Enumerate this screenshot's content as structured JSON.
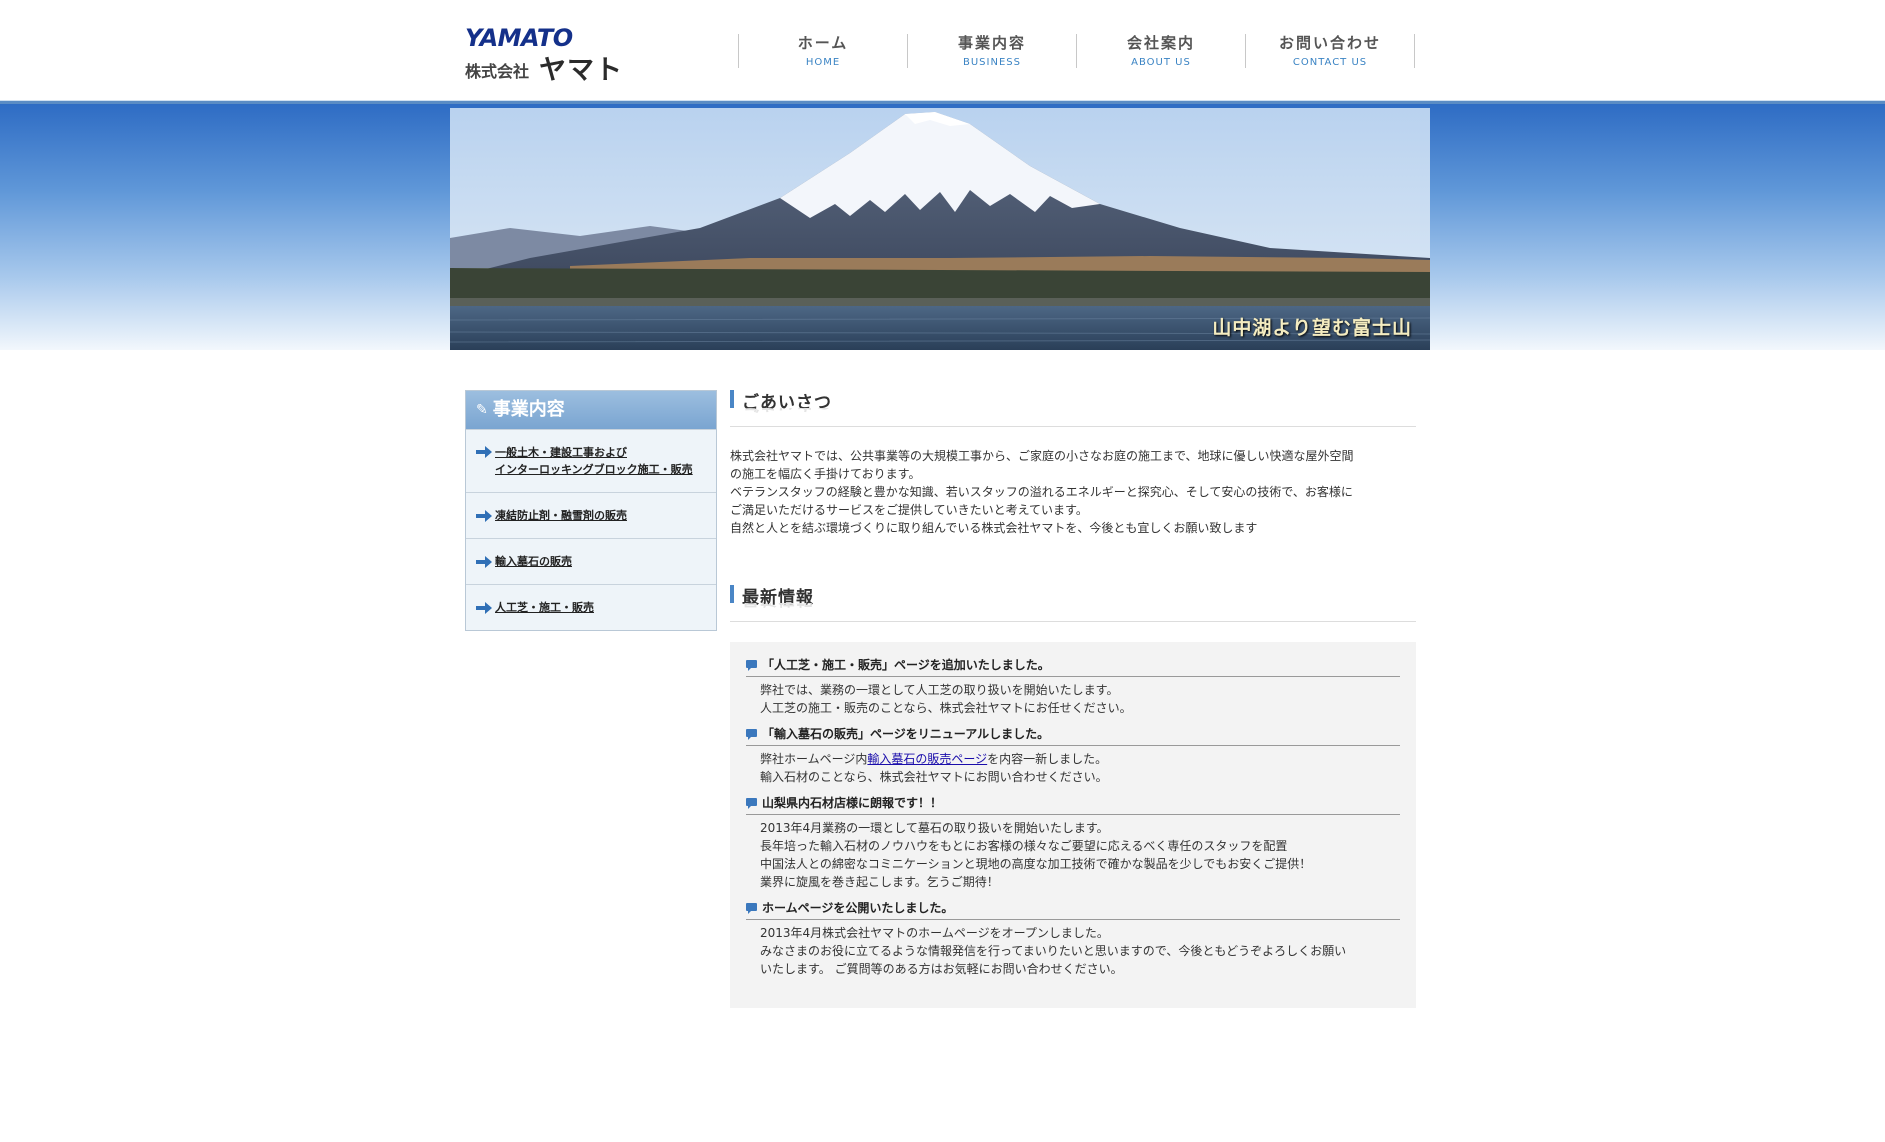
{
  "header": {
    "logo_en": "YAMATO",
    "logo_jp_prefix": "株式会社",
    "logo_jp_name": "ヤマト",
    "nav": [
      {
        "jp": "ホーム",
        "en": "HOME"
      },
      {
        "jp": "事業内容",
        "en": "BUSINESS"
      },
      {
        "jp": "会社案内",
        "en": "ABOUT US"
      },
      {
        "jp": "お問い合わせ",
        "en": "CONTACT US"
      }
    ]
  },
  "hero": {
    "caption": "山中湖より望む富士山"
  },
  "sidebar": {
    "title": "事業内容",
    "items": [
      {
        "line1": "一般土木・建設工事および",
        "line2": "インターロッキングブロック施工・販売"
      },
      {
        "line1": "凍結防止剤・融雪剤の販売",
        "line2": ""
      },
      {
        "line1": "輸入墓石の販売",
        "line2": ""
      },
      {
        "line1": "人工芝・施工・販売",
        "line2": ""
      }
    ]
  },
  "greeting": {
    "title": "ごあいさつ",
    "lines": [
      "株式会社ヤマトでは、公共事業等の大規模工事から、ご家庭の小さなお庭の施工まで、地球に優しい快適な屋外空間",
      "の施工を幅広く手掛けております。",
      "ベテランスタッフの経験と豊かな知識、若いスタッフの溢れるエネルギーと探究心、そして安心の技術で、お客様に",
      "ご満足いただけるサービスをご提供していきたいと考えています。",
      "自然と人とを結ぶ環境づくりに取り組んでいる株式会社ヤマトを、今後とも宜しくお願い致します"
    ]
  },
  "news": {
    "title": "最新情報",
    "items": [
      {
        "title": "「人工芝・施工・販売」ページを追加いたしました。",
        "lines": [
          "弊社では、業務の一環として人工芝の取り扱いを開始いたします。",
          "人工芝の施工・販売のことなら、株式会社ヤマトにお任せください。"
        ]
      },
      {
        "title": "「輸入墓石の販売」ページをリニューアルしました。",
        "line1_prefix": "弊社ホームページ内",
        "line1_link": "輸入墓石の販売ページ",
        "line1_suffix": "を内容一新しました。",
        "lines": [
          "輸入石材のことなら、株式会社ヤマトにお問い合わせください。"
        ]
      },
      {
        "title": "山梨県内石材店様に朗報です！！",
        "lines": [
          "2013年4月業務の一環として墓石の取り扱いを開始いたします。",
          "長年培った輸入石材のノウハウをもとにお客様の様々なご要望に応えるべく専任のスタッフを配置",
          "中国法人との綿密なコミニケーションと現地の高度な加工技術で確かな製品を少しでもお安くご提供！",
          "業界に旋風を巻き起こします。乞うご期待！"
        ]
      },
      {
        "title": "ホームページを公開いたしました。",
        "lines": [
          "2013年4月株式会社ヤマトのホームページをオープンしました。",
          "みなさまのお役に立てるような情報発信を行ってまいりたいと思いますので、今後ともどうぞよろしくお願い",
          "いたします。 ご質問等のある方はお気軽にお問い合わせください。"
        ]
      }
    ]
  },
  "colors": {
    "accent": "#4a86c6",
    "nav_en": "#3b84c4",
    "logo": "#14308a",
    "sidebar_header": "#7aa5d1"
  },
  "icons": [
    "pencil-icon",
    "arrow-right-icon",
    "speech-bubble-icon"
  ]
}
